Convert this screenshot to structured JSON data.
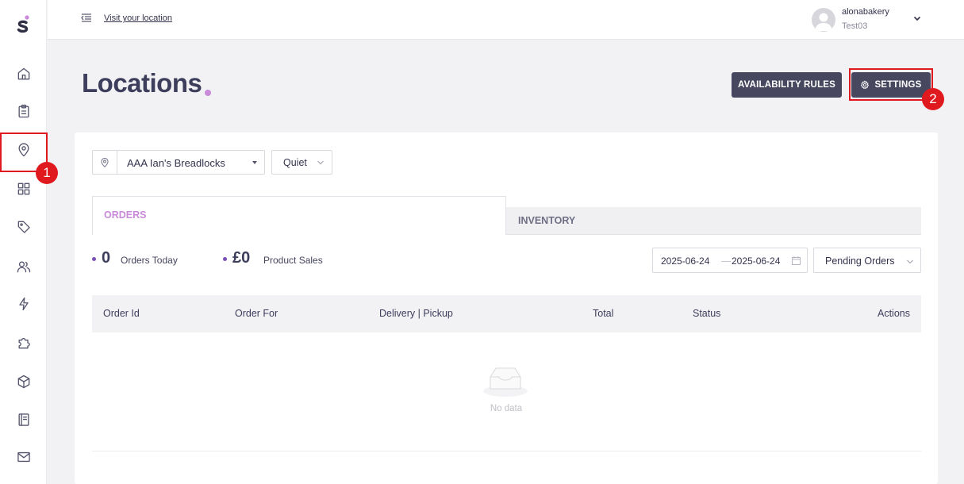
{
  "brand": {
    "logo_letter": "S",
    "accent": "#c98ad9"
  },
  "sidebar": {
    "items": [
      {
        "name": "home",
        "icon": "home-icon"
      },
      {
        "name": "orders",
        "icon": "clipboard-icon"
      },
      {
        "name": "locations",
        "icon": "map-pin-icon",
        "active": true
      },
      {
        "name": "dashboard",
        "icon": "grid-icon"
      },
      {
        "name": "tags",
        "icon": "tag-icon"
      },
      {
        "name": "customers",
        "icon": "users-icon"
      },
      {
        "name": "integrations",
        "icon": "lightning-icon"
      },
      {
        "name": "plugins",
        "icon": "puzzle-icon"
      },
      {
        "name": "products",
        "icon": "box-icon"
      },
      {
        "name": "notes",
        "icon": "book-icon"
      },
      {
        "name": "messages",
        "icon": "mail-icon"
      }
    ]
  },
  "annotations": {
    "marker_1": "1",
    "marker_2": "2"
  },
  "topbar": {
    "visit_link": "Visit your location",
    "user_name": "alonabakery",
    "user_sub": "Test03"
  },
  "header": {
    "title": "Locations",
    "availability_label": "AVAILABILITY RULES",
    "settings_label": "SETTINGS"
  },
  "filters": {
    "location_value": "AAA Ian's Breadlocks",
    "status_value": "Quiet"
  },
  "tabs": {
    "orders": "ORDERS",
    "inventory": "INVENTORY"
  },
  "stats": {
    "orders_count": "0",
    "orders_label": "Orders Today",
    "sales_value": "£0",
    "sales_label": "Product Sales"
  },
  "date_range": {
    "start": "2025-06-24",
    "end": "2025-06-24"
  },
  "order_filter": {
    "value": "Pending Orders"
  },
  "table": {
    "columns": [
      "Order Id",
      "Order For",
      "Delivery | Pickup",
      "Total",
      "Status",
      "Actions"
    ],
    "empty_text": "No data"
  }
}
